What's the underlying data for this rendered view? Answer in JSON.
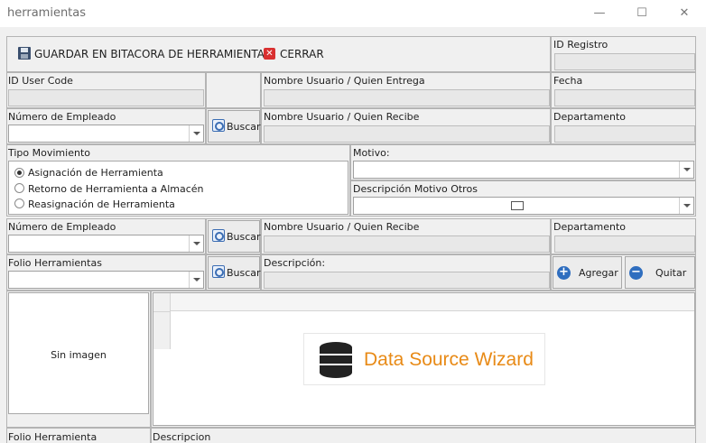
{
  "window": {
    "title": "herramientas",
    "minimize": "—",
    "maximize": "☐",
    "close": "✕"
  },
  "toolbar": {
    "save_label": "GUARDAR EN BITACORA DE HERRAMIENTAS",
    "close_label": "CERRAR"
  },
  "labels": {
    "id_registro": "ID Registro",
    "id_user_code": "ID User Code",
    "nombre_entrega": "Nombre Usuario / Quien Entrega",
    "fecha": "Fecha",
    "numero_empleado": "Número de Empleado",
    "buscar": "Buscar",
    "nombre_recibe": "Nombre Usuario / Quien Recibe",
    "departamento": "Departamento",
    "tipo_movimiento": "Tipo Movimiento",
    "motivo": "Motivo:",
    "descripcion_motivo": "Descripción Motivo Otros",
    "numero_empleado_2": "Número de Empleado",
    "buscar_2": "Buscar",
    "nombre_recibe_2": "Nombre Usuario / Quien Recibe",
    "departamento_2": "Departamento",
    "folio_herramientas": "Folio Herramientas",
    "buscar_3": "Buscar",
    "descripcion": "Descripción:",
    "agregar": "Agregar",
    "quitar": "Quitar",
    "sin_imagen": "Sin imagen",
    "folio_herramienta": "Folio Herramienta",
    "descripcion_col": "Descripcion"
  },
  "tipo_movimiento_options": [
    {
      "label": "Asignación de Herramienta",
      "selected": true
    },
    {
      "label": "Retorno de Herramienta a Almacén",
      "selected": false
    },
    {
      "label": "Reasignación de Herramienta",
      "selected": false
    }
  ],
  "grid": {
    "wizard_label": "Data Source Wizard",
    "wizard_color": "#e88a16"
  }
}
